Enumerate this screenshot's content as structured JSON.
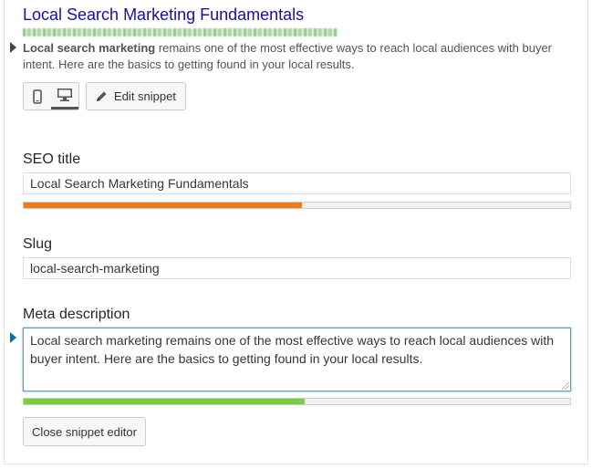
{
  "preview": {
    "title": "Local Search Marketing Fundamentals",
    "description_bold": "Local search marketing",
    "description_rest": " remains one of the most effective ways to reach local audiences with buyer intent. Here are the basics to getting found in your local results."
  },
  "toolbar": {
    "edit_snippet_label": "Edit snippet",
    "mobile_icon": "mobile-icon",
    "desktop_icon": "desktop-icon",
    "selected_mode": "desktop"
  },
  "seo_title": {
    "label": "SEO title",
    "value": "Local Search Marketing Fundamentals",
    "progress": 0.51,
    "progress_color": "#ee7c1b"
  },
  "slug": {
    "label": "Slug",
    "value": "local-search-marketing"
  },
  "meta_description": {
    "label": "Meta description",
    "value": "Local search marketing remains one of the most effective ways to reach local audiences with buyer intent. Here are the basics to getting found in your local results.",
    "progress": 0.515,
    "progress_color": "#7ad03a"
  },
  "close_button_label": "Close snippet editor"
}
